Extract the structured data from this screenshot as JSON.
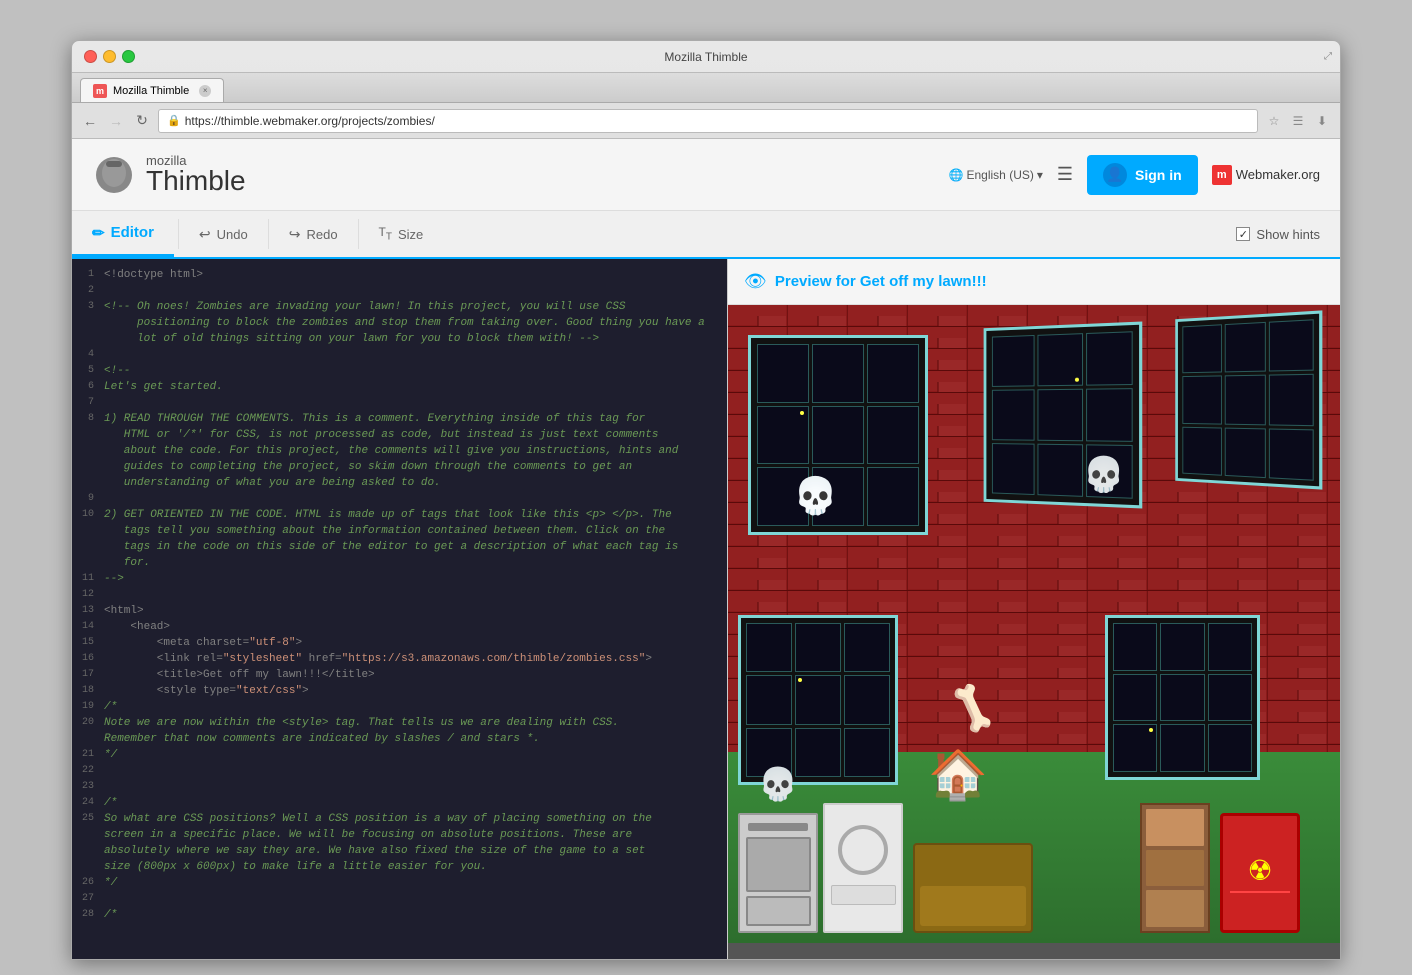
{
  "window": {
    "title": "Mozilla Thimble",
    "url": "https://thimble.webmaker.org/projects/zombies/",
    "tab_label": "Mozilla Thimble"
  },
  "header": {
    "logo_mozilla": "mozilla",
    "logo_thimble": "Thimble",
    "lang": "English (US)",
    "menu_icon": "☰",
    "sign_in": "Sign in",
    "webmaker": "Webmaker.org"
  },
  "toolbar": {
    "editor_label": "Editor",
    "undo_label": "Undo",
    "redo_label": "Redo",
    "size_label": "Size",
    "show_hints_label": "Show hints",
    "editor_icon": "✏",
    "undo_icon": "↩",
    "redo_icon": "↪"
  },
  "preview": {
    "title": "Preview for Get off my lawn!!!",
    "eye_icon": "👁"
  },
  "code_lines": [
    {
      "num": 1,
      "content": "<!doctype html>",
      "type": "tag"
    },
    {
      "num": 2,
      "content": "",
      "type": "plain"
    },
    {
      "num": 3,
      "content": "<!-- Oh noes! Zombies are invading your lawn! In this project, you will use CSS",
      "type": "comment"
    },
    {
      "num": 3,
      "content": "     positioning to block the zombies and stop them from taking over. Good thing you have a",
      "type": "comment"
    },
    {
      "num": 3,
      "content": "     lot of old things sitting on your lawn for you to block them with! -->",
      "type": "comment"
    },
    {
      "num": 4,
      "content": "",
      "type": "plain"
    },
    {
      "num": 5,
      "content": "<!--",
      "type": "comment"
    },
    {
      "num": 6,
      "content": "Let's get started.",
      "type": "comment"
    },
    {
      "num": 7,
      "content": "",
      "type": "plain"
    },
    {
      "num": 8,
      "content": "1) READ THROUGH THE COMMENTS. This is a comment. Everything inside of this tag for",
      "type": "comment"
    },
    {
      "num": 8,
      "content": "   HTML or '/*' for CSS, is not processed as code, but instead is just text comments",
      "type": "comment"
    },
    {
      "num": 8,
      "content": "   about the code. For this project, the comments will give you instructions, hints and",
      "type": "comment"
    },
    {
      "num": 8,
      "content": "   guides to completing the project, so skim down through the comments to get an",
      "type": "comment"
    },
    {
      "num": 8,
      "content": "   understanding of what you are being asked to do.",
      "type": "comment"
    },
    {
      "num": 9,
      "content": "",
      "type": "plain"
    },
    {
      "num": 10,
      "content": "2) GET ORIENTED IN THE CODE. HTML is made up of tags that look like this <p> </p>. The",
      "type": "comment"
    },
    {
      "num": 10,
      "content": "   tags tell you something about the information contained between them. Click on the",
      "type": "comment"
    },
    {
      "num": 10,
      "content": "   tags in the code on this side of the editor to get a description of what each tag is",
      "type": "comment"
    },
    {
      "num": 10,
      "content": "   for.",
      "type": "comment"
    },
    {
      "num": 11,
      "content": "-->",
      "type": "comment"
    },
    {
      "num": 12,
      "content": "",
      "type": "plain"
    },
    {
      "num": 13,
      "content": "<html>",
      "type": "tag"
    },
    {
      "num": 14,
      "content": "    <head>",
      "type": "tag"
    },
    {
      "num": 15,
      "content": "        <meta charset=\"utf-8\">",
      "type": "tag"
    },
    {
      "num": 16,
      "content": "        <link rel=\"stylesheet\" href=\"https://s3.amazonaws.com/thimble/zombies.css\">",
      "type": "tag"
    },
    {
      "num": 17,
      "content": "        <title>Get off my lawn!!!</title>",
      "type": "tag"
    },
    {
      "num": 18,
      "content": "        <style type=\"text/css\">",
      "type": "tag"
    },
    {
      "num": 19,
      "content": "/*",
      "type": "comment"
    },
    {
      "num": 20,
      "content": "Note we are now within the <style> tag. That tells us we are dealing with CSS.",
      "type": "comment"
    },
    {
      "num": 20,
      "content": "Remember that now comments are indicated by slashes / and stars *.",
      "type": "comment"
    },
    {
      "num": 21,
      "content": "*/",
      "type": "comment"
    },
    {
      "num": 22,
      "content": "",
      "type": "plain"
    },
    {
      "num": 23,
      "content": "",
      "type": "plain"
    },
    {
      "num": 24,
      "content": "/*",
      "type": "comment"
    },
    {
      "num": 25,
      "content": "So what are CSS positions? Well a CSS position is a way of placing something on the",
      "type": "comment"
    },
    {
      "num": 25,
      "content": "screen in a specific place. We will be focusing on absolute positions. These are",
      "type": "comment"
    },
    {
      "num": 25,
      "content": "absolutely where we say they are. We have also fixed the size of the game to a set",
      "type": "comment"
    },
    {
      "num": 25,
      "content": "size (800px x 600px) to make life a little easier for you.",
      "type": "comment"
    },
    {
      "num": 26,
      "content": "*/",
      "type": "comment"
    },
    {
      "num": 27,
      "content": "",
      "type": "plain"
    },
    {
      "num": 28,
      "content": "/*",
      "type": "comment"
    }
  ]
}
